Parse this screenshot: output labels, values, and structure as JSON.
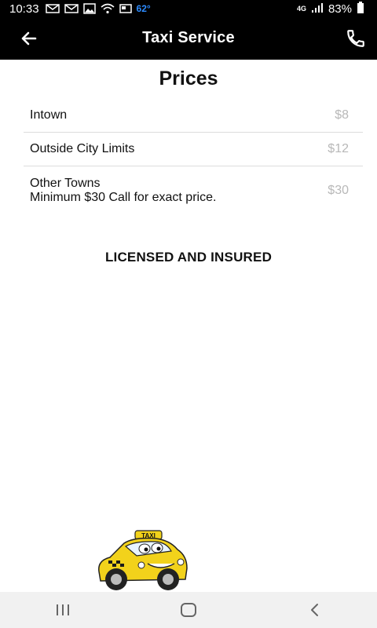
{
  "status_bar": {
    "time": "10:33",
    "temperature": "62°",
    "network": "4G",
    "battery": "83%",
    "icons": [
      "email-icon",
      "email-icon",
      "image-icon",
      "wifi-icon",
      "news-icon",
      "signal-icon",
      "battery-icon"
    ]
  },
  "app_bar": {
    "title": "Taxi Service",
    "back_icon": "arrow-back-icon",
    "phone_icon": "phone-icon"
  },
  "prices": {
    "heading": "Prices",
    "items": [
      {
        "name_lines": [
          "Intown"
        ],
        "price": "$8"
      },
      {
        "name_lines": [
          "Outside City Limits"
        ],
        "price": "$12"
      },
      {
        "name_lines": [
          "Other Towns",
          "Minimum $30 Call for exact price."
        ],
        "price": "$30"
      }
    ]
  },
  "footer_text": "LICENSED AND INSURED",
  "taxi_image": {
    "label": "TAXI",
    "colors": {
      "body": "#f2d21b",
      "outline": "#222222",
      "checker": "#1a1a1a"
    }
  },
  "nav_bar": {
    "buttons": [
      "recent-apps-icon",
      "home-icon",
      "back-icon"
    ]
  },
  "colors": {
    "bar_background": "#000000",
    "temperature": "#2d8cff",
    "price_text": "#b8b8b8",
    "divider": "#dcdcdc"
  }
}
